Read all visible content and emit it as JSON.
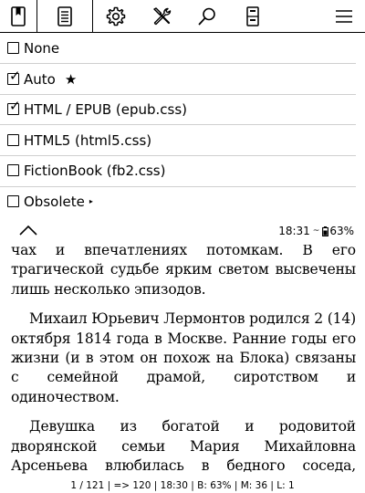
{
  "toolbar": {
    "tools": [
      {
        "name": "bookmark-tool",
        "icon": "bookmark-icon"
      },
      {
        "name": "document-tool",
        "icon": "document-lines-icon"
      },
      {
        "name": "settings-tool",
        "icon": "gear-icon"
      },
      {
        "name": "tools-tool",
        "icon": "wrench-screwdriver-icon"
      },
      {
        "name": "search-tool",
        "icon": "search-icon"
      },
      {
        "name": "navigation-tool",
        "icon": "book-page-icon"
      },
      {
        "name": "menu-tool",
        "icon": "hamburger-menu-icon"
      }
    ],
    "active_index": 1
  },
  "menu": {
    "items": [
      {
        "label": "None",
        "checked": false
      },
      {
        "label": "Auto",
        "checked": true,
        "suffix": "★"
      },
      {
        "label": "HTML / EPUB (epub.css)",
        "checked": true
      },
      {
        "label": "HTML5 (html5.css)",
        "checked": false
      },
      {
        "label": "FictionBook (fb2.css)",
        "checked": false
      },
      {
        "label": "Obsolete",
        "checked": false,
        "suffix": "▸"
      }
    ]
  },
  "status": {
    "collapse_icon": "chevron-up-icon",
    "time": "18:31",
    "charge_icon": "charging-tilde-icon",
    "battery_icon": "battery-icon",
    "battery": "63%"
  },
  "reader": {
    "paragraph1": "чах и впечатлениях потомкам. В его трагической судьбе ярким светом высвечены лишь несколько эпизодов.",
    "paragraph2": "Михаил Юрьевич Лермонтов родился 2 (14) октября 1814 года в Москве. Ранние годы его жизни (и в этом он похож на Блока) связаны с семейной драмой, сиротством и одиночеством.",
    "paragraph3": "Девушка из богатой и родовитой дворянской семьи Мария Михайловна Арсеньева влюбилась в бедного соседа, отставного капитана Юрия Петровича Лермонтова, преодолевая сопротивление"
  },
  "footer": {
    "text": "1 / 121 | => 120 | 18:30 | B: 63% | M: 36 | L: 1"
  }
}
